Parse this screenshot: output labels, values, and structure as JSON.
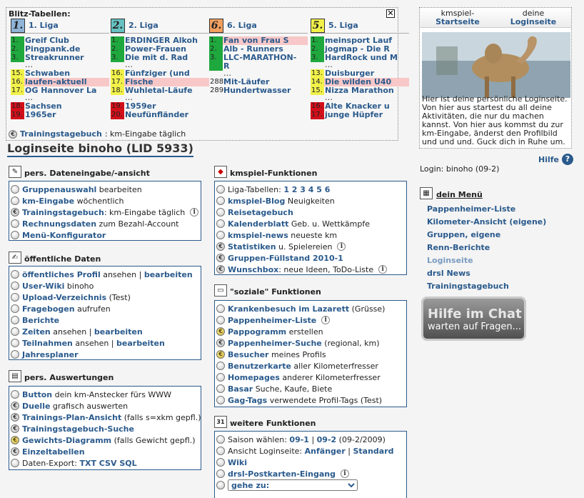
{
  "blitz": {
    "title": "Blitz-Tabellen:",
    "close": "✕",
    "leagues": [
      {
        "num": "1.",
        "name": "1. Liga",
        "numbg": "#8fb4d8",
        "entries": [
          [
            "1.",
            "Greif Club",
            "g",
            ""
          ],
          [
            "2.",
            "Pingpank.de",
            "g",
            ""
          ],
          [
            "3.",
            "Streakrunner",
            "g",
            ""
          ],
          [
            "…",
            "",
            "",
            ""
          ],
          [
            "15.",
            "Schwaben",
            "y",
            ""
          ],
          [
            "16.",
            "laufen-aktuell",
            "y",
            "hl"
          ],
          [
            "17.",
            "OG Hannover La",
            "y",
            ""
          ],
          [
            "…",
            "",
            "",
            ""
          ],
          [
            "18.",
            "Sachsen",
            "r",
            ""
          ],
          [
            "19.",
            "1965er",
            "r",
            ""
          ]
        ]
      },
      {
        "num": "2.",
        "name": "2. Liga",
        "numbg": "#66c2c2",
        "entries": [
          [
            "1.",
            "ERDINGER Alkoh",
            "g",
            ""
          ],
          [
            "2.",
            "Power-Frauen",
            "g",
            ""
          ],
          [
            "3.",
            "Die mit d. Rad",
            "g",
            ""
          ],
          [
            "…",
            "",
            "",
            ""
          ],
          [
            "16.",
            "Fünfziger (und",
            "y",
            ""
          ],
          [
            "17.",
            "Fische",
            "y",
            "hl"
          ],
          [
            "18.",
            "Wuhletal-Läufe",
            "y",
            ""
          ],
          [
            "…",
            "",
            "",
            ""
          ],
          [
            "19.",
            "1959er",
            "r",
            ""
          ],
          [
            "20.",
            "Neufünfländer",
            "r",
            ""
          ]
        ]
      },
      {
        "num": "6.",
        "name": "6. Liga",
        "numbg": "#f1a060",
        "entries": [
          [
            "1.",
            "Fan von Frau S",
            "g",
            "hl"
          ],
          [
            "2.",
            "Alb - Runners",
            "g",
            ""
          ],
          [
            "3.",
            "LLC-MARATHON-",
            "g",
            ""
          ],
          [
            "",
            "R",
            "g",
            ""
          ],
          [
            "…",
            "",
            "",
            ""
          ],
          [
            "288.",
            "Mit-Läufer",
            "",
            ""
          ],
          [
            "289.",
            "Hundertwasser",
            "",
            ""
          ]
        ]
      },
      {
        "num": "5.",
        "name": "5. Liga",
        "numbg": "#f1f14a",
        "entries": [
          [
            "1.",
            "meinsport Lauf",
            "g",
            ""
          ],
          [
            "2.",
            "jogmap - Die R",
            "g",
            ""
          ],
          [
            "3.",
            "HardRock und M",
            "g",
            ""
          ],
          [
            "…",
            "",
            "",
            ""
          ],
          [
            "13.",
            "Duisburger",
            "y",
            ""
          ],
          [
            "14.",
            "Die wilden Ü40",
            "y",
            "hl"
          ],
          [
            "15.",
            "Nizza Marathon",
            "y",
            ""
          ],
          [
            "…",
            "",
            "",
            ""
          ],
          [
            "16.",
            "Alte Knacker u",
            "r",
            ""
          ],
          [
            "17.",
            "junge Hüpfer",
            "r",
            ""
          ]
        ]
      }
    ],
    "foot_link": "Trainingstagebuch",
    "foot_text": ": km-Eingabe täglich"
  },
  "title": "Loginseite binoho (LID 5933)",
  "panels": {
    "dateneingabe": {
      "head": "pers. Dateneingabe/-ansicht",
      "rows": [
        {
          "i": "c",
          "l": "Gruppenauswahl",
          "t": " bearbeiten"
        },
        {
          "i": "c",
          "l": "km-Eingabe",
          "t": " wöchentlich"
        },
        {
          "i": "e",
          "l": "Trainingstagebuch",
          "t": ": km-Eingabe täglich",
          "info": "i"
        },
        {
          "i": "c",
          "l": "Rechnungsdaten",
          "t": " zum Bezahl-Account"
        },
        {
          "i": "c",
          "l": "Menü-Konfigurator",
          "t": ""
        }
      ]
    },
    "oeffentlich": {
      "head": "öffentliche Daten",
      "rows": [
        {
          "i": "c",
          "l": "öffentliches Profil",
          "t": " ansehen | ",
          "l2": "bearbeiten"
        },
        {
          "i": "c",
          "l": "User-Wiki",
          "t": " binoho"
        },
        {
          "i": "c",
          "l": "Upload-Verzeichnis",
          "t": " (Test)"
        },
        {
          "i": "c",
          "l": "Fragebogen",
          "t": " aufrufen"
        },
        {
          "i": "c",
          "l": "Berichte",
          "t": ""
        },
        {
          "i": "c",
          "l": "Zeiten",
          "t": " ansehen | ",
          "l2": "bearbeiten"
        },
        {
          "i": "c",
          "l": "Teilnahmen",
          "t": " ansehen | ",
          "l2": "bearbeiten"
        },
        {
          "i": "c",
          "l": "Jahresplaner",
          "t": ""
        }
      ]
    },
    "auswertungen": {
      "head": "pers. Auswertungen",
      "rows": [
        {
          "i": "c",
          "l": "Button",
          "t": " dein km-Anstecker fürs WWW"
        },
        {
          "i": "e",
          "l": "Duelle",
          "t": " grafisch auswerten"
        },
        {
          "i": "e",
          "l": "Trainings-Plan-Ansicht",
          "t": " (falls s=xkm gepfl.)"
        },
        {
          "i": "e",
          "l": "Trainingstagebuch-Suche",
          "t": ""
        },
        {
          "i": "g",
          "l": "Gewichts-Diagramm",
          "t": " (falls Gewicht gepfl.)"
        },
        {
          "i": "e",
          "l": "Einzeltabellen",
          "t": ""
        },
        {
          "i": "c",
          "l": "",
          "t": "Daten-Export: ",
          "l2": "TXT CSV SQL"
        }
      ]
    },
    "kmspiel": {
      "head": "kmspiel-Funktionen",
      "rows": [
        {
          "i": "c",
          "l": "",
          "t": "Liga-Tabellen: ",
          "l2": "1  2  3  4  5  6"
        },
        {
          "i": "c",
          "l": "kmspiel-Blog",
          "t": " Neuigkeiten"
        },
        {
          "i": "c",
          "l": "Reisetagebuch",
          "t": ""
        },
        {
          "i": "c",
          "l": "Kalenderblatt",
          "t": " Geb. u. Wettkämpfe"
        },
        {
          "i": "c",
          "l": "kmspiel-news",
          "t": " neueste km"
        },
        {
          "i": "e",
          "l": "Statistiken",
          "t": " u. Spielereien",
          "info": "i"
        },
        {
          "i": "e",
          "l": "Gruppen-Füllstand 2010-1",
          "t": ""
        },
        {
          "i": "e",
          "l": "Wunschbox",
          "t": ": neue Ideen, ToDo-Liste",
          "info": "i"
        }
      ]
    },
    "sozial": {
      "head": "\"soziale\" Funktionen",
      "rows": [
        {
          "i": "c",
          "l": "Krankenbesuch im Lazarett",
          "t": " (Grüsse)"
        },
        {
          "i": "c",
          "l": "Pappenheimer-Liste",
          "t": "",
          "info": "i"
        },
        {
          "i": "g",
          "l": "Pappogramm",
          "t": " erstellen"
        },
        {
          "i": "e",
          "l": "Pappenheimer-Suche",
          "t": " (regional, km)"
        },
        {
          "i": "g",
          "l": "Besucher",
          "t": " meines Profils"
        },
        {
          "i": "c",
          "l": "Benutzerkarte",
          "t": " aller Kilometerfresser"
        },
        {
          "i": "c",
          "l": "Homepages",
          "t": " anderer Kilometerfresser"
        },
        {
          "i": "c",
          "l": "Basar",
          "t": " Suche, Kaufe, Biete"
        },
        {
          "i": "c",
          "l": "Gag-Tags",
          "t": " verwendete Profil-Tags (Test)"
        }
      ]
    },
    "weitere": {
      "head": "weitere Funktionen",
      "rows": [
        {
          "i": "c",
          "l": "",
          "t": "Saison wählen: ",
          "l2": "09-1",
          "t2": " | ",
          "l3": "09-2",
          "t3": " (09-2/2009)"
        },
        {
          "i": "c",
          "l": "",
          "t": "Ansicht Loginseite: ",
          "l2": "Anfänger",
          "t2": " | ",
          "l3": "Standard"
        },
        {
          "i": "c",
          "l": "Wiki",
          "t": ""
        },
        {
          "i": "c",
          "l": "drsl-Postkarten-Eingang",
          "t": "",
          "info": "i"
        }
      ],
      "select": "gehe zu:"
    }
  },
  "right": {
    "tab1a": "kmspiel-",
    "tab1b": "Startseite",
    "tab2a": "deine",
    "tab2b": "Loginseite",
    "text": "Hier ist deine persönliche Loginseite. Von hier aus startest du all deine Aktivitäten, die nur du machen kannst. Von hier aus kommst du zur km-Eingabe, änderst den Profilbild und und und. Guck dich in Ruhe um.",
    "help": "Hilfe",
    "login": "Login: binoho (09-2)",
    "menu_title": "dein Menü",
    "menu": [
      "Pappenheimer-Liste",
      "Kilometer-Ansicht (eigene)",
      "Gruppen, eigene",
      "Renn-Berichte",
      "Loginseite",
      "drsl News",
      "Trainingstagebuch"
    ],
    "chat_h": "Hilfe im Chat",
    "chat_s": "warten auf Fragen..."
  }
}
